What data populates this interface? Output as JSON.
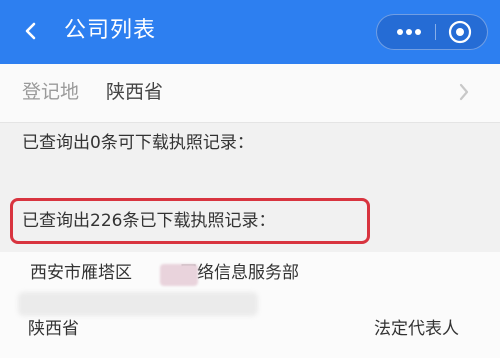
{
  "header": {
    "title": "公司列表",
    "back_icon": "chevron-left-icon",
    "more_icon": "more-dots-icon",
    "close_icon": "target-close-icon",
    "bg_color": "#2d7ff0"
  },
  "filter": {
    "label": "登记地",
    "value": "陕西省",
    "chevron_icon": "chevron-right-icon"
  },
  "results": {
    "downloadable_text": "已查询出0条可下载执照记录：",
    "downloaded_text": "已查询出226条已下载执照记录：",
    "highlight_color": "#d8343f"
  },
  "company_item": {
    "name": "西安市雁塔区",
    "name_suffix": "网络信息服务部",
    "province": "陕西省",
    "legal_rep_label": "法定代表人"
  }
}
